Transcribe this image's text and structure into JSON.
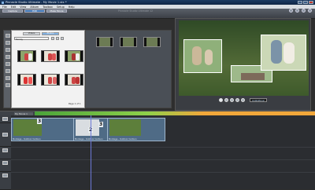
{
  "window": {
    "title": "Pinnacle Studio Ultimate - My Movie 1.stx *",
    "controls": [
      "minimize-icon",
      "maximize-icon",
      "close-icon"
    ]
  },
  "menu": [
    "File",
    "Edit",
    "View",
    "Album",
    "Toolbox",
    "Setup",
    "Help"
  ],
  "mode_tabs": [
    {
      "label": "Capture",
      "active": false
    },
    {
      "label": "Edit",
      "active": true
    },
    {
      "label": "Make Movie",
      "active": false
    }
  ],
  "brand": "Pinnacle Studio Ultimate 12",
  "header_icons": [
    "undo-icon",
    "redo-icon",
    "help-icon",
    "fullscreen-icon"
  ],
  "library": {
    "tabs": [
      "Videos",
      "Photos"
    ],
    "active_tab": "Photos",
    "category_value": "Family",
    "page_label": "Page 1 of 1",
    "thumb_count": 6
  },
  "master_menu": {
    "thumb_count": 3
  },
  "preview": {
    "timecode": "0:00:05.12",
    "transport": [
      "go-start-icon",
      "rewind-icon",
      "play-icon",
      "fast-forward-icon",
      "go-end-icon"
    ]
  },
  "timeline": {
    "project_title": "My Movie 1",
    "clips": [
      {
        "label": "Montage - Outdoor Cartoon"
      },
      {
        "label": "Montage - Outdoor Cartoon"
      },
      {
        "label": "Montage - Outdoor Cartoon"
      }
    ],
    "transition_numbers": [
      "3",
      "2",
      "3"
    ]
  },
  "colors": {
    "accent": "#3d78b8",
    "ruler_green": "#6fc43f",
    "ruler_orange": "#f2a73a"
  }
}
